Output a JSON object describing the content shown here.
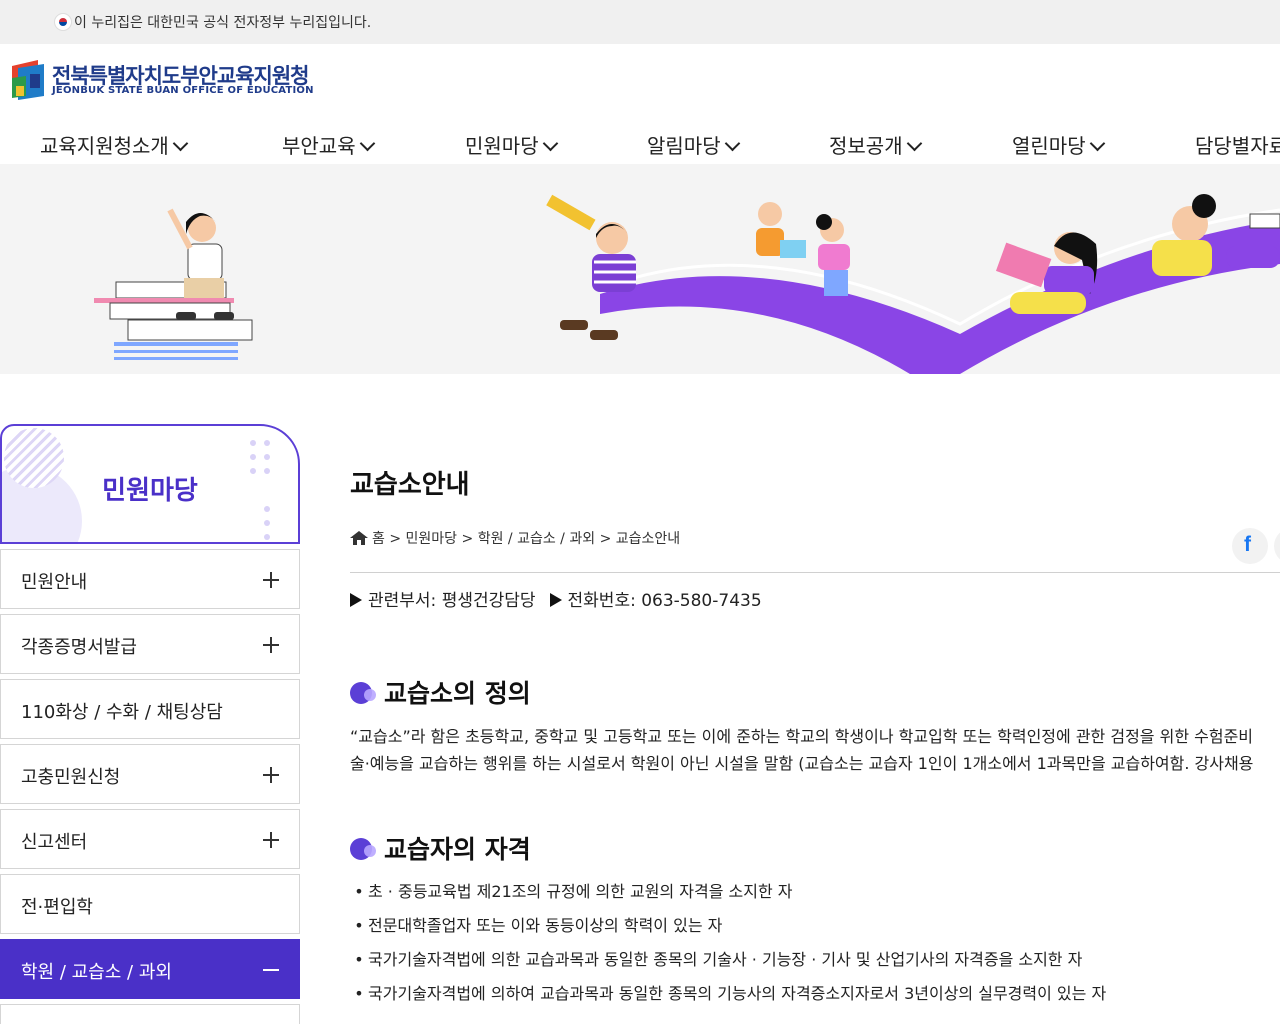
{
  "gov_notice": {
    "text": "이 누리집은 대한민국 공식 전자정부 누리집입니다."
  },
  "logo": {
    "name_ko": "전북특별자치도부안교육지원청",
    "name_en": "JEONBUK STATE BUAN OFFICE OF EDUCATION"
  },
  "gnb": {
    "items": [
      {
        "label": "교육지원청소개"
      },
      {
        "label": "부안교육"
      },
      {
        "label": "민원마당"
      },
      {
        "label": "알림마당"
      },
      {
        "label": "정보공개"
      },
      {
        "label": "열린마당"
      },
      {
        "label": "담당별자료"
      }
    ]
  },
  "lnb": {
    "title": "민원마당",
    "items": [
      {
        "label": "민원안내",
        "expandable": true
      },
      {
        "label": "각종증명서발급",
        "expandable": true
      },
      {
        "label": "110화상 / 수화 / 채팅상담",
        "expandable": false
      },
      {
        "label": "고충민원신청",
        "expandable": true
      },
      {
        "label": "신고센터",
        "expandable": true
      },
      {
        "label": "전·편입학",
        "expandable": false
      },
      {
        "label": "학원 / 교습소 / 과외",
        "expandable": true,
        "active": true
      }
    ]
  },
  "page": {
    "title": "교습소안내",
    "breadcrumb": [
      "홈",
      "민원마당",
      "학원 / 교습소 / 과외",
      "교습소안내"
    ],
    "dept_label": "관련부서: 평생건강담당",
    "phone_label": "전화번호: 063-580-7435"
  },
  "sections": {
    "definition": {
      "title": "교습소의 정의",
      "lines": [
        "“교습소”라 함은 초등학교, 중학교 및 고등학교 또는 이에 준하는 학교의 학생이나 학교입학 또는 학력인정에 관한 검정을 위한 수험준비",
        "술·예능을 교습하는 행위를 하는 시설로서 학원이 아닌 시설을 말함 (교습소는 교습자 1인이 1개소에서 1과목만을 교습하여함. 강사채용"
      ]
    },
    "qualification": {
      "title": "교습자의 자격",
      "items": [
        "초 · 중등교육법 제21조의 규정에 의한 교원의 자격을 소지한 자",
        "전문대학졸업자 또는 이와 동등이상의 학력이 있는 자",
        "국가기술자격법에 의한 교습과목과 동일한 종목의 기술사 · 기능장 · 기사 및 산업기사의 자격증을 소지한 자",
        "국가기술자격법에 의하여 교습과목과 동일한 종목의 기능사의 자격증소지자로서 3년이상의 실무경력이 있는 자"
      ]
    }
  },
  "colors": {
    "accent": "#4a30c8",
    "topbar_bg": "#f0f0f0",
    "banner_bg": "#f4f4f4",
    "facebook": "#1877f2"
  },
  "icons": [
    "korea-flag-icon",
    "home-icon",
    "plus-icon",
    "minus-icon",
    "chevron-down-icon",
    "facebook-icon"
  ]
}
